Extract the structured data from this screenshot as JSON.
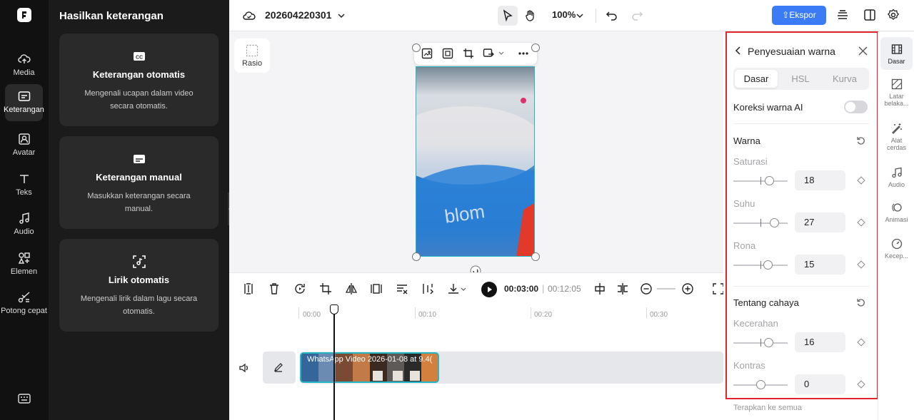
{
  "rail": {
    "items": [
      {
        "label": "Media",
        "icon": "cloud-upload-icon"
      },
      {
        "label": "Keterangan",
        "icon": "captions-icon"
      },
      {
        "label": "Avatar",
        "icon": "avatar-icon"
      },
      {
        "label": "Teks",
        "icon": "text-icon"
      },
      {
        "label": "Audio",
        "icon": "music-icon"
      },
      {
        "label": "Elemen",
        "icon": "elements-icon"
      },
      {
        "label": "Potong cepat",
        "icon": "quick-cut-icon"
      }
    ]
  },
  "panel": {
    "title": "Hasilkan keterangan",
    "cards": [
      {
        "title": "Keterangan otomatis",
        "desc": "Mengenali ucapan dalam video secara otomatis."
      },
      {
        "title": "Keterangan manual",
        "desc": "Masukkan keterangan secara manual."
      },
      {
        "title": "Lirik otomatis",
        "desc": "Mengenali lirik dalam lagu secara otomatis."
      }
    ]
  },
  "topbar": {
    "project_name": "202604220301",
    "zoom": "100%",
    "export_label": "Ekspor"
  },
  "canvas": {
    "ratio_label": "Rasio"
  },
  "timeline": {
    "current_time": "00:03:00",
    "separator": "|",
    "total_time": "00:12:05",
    "ticks": [
      "00:00",
      "00:10",
      "00:20",
      "00:30"
    ],
    "clip_label": "WhatsApp Video 2026-01-08 at 9.4("
  },
  "adjust": {
    "title": "Penyesuaian warna",
    "tabs": [
      "Dasar",
      "HSL",
      "Kurva"
    ],
    "active_tab": "Dasar",
    "ai_label": "Koreksi warna AI",
    "ai_enabled": false,
    "sections": [
      {
        "title": "Warna",
        "rows": [
          {
            "label": "Saturasi",
            "value": "18"
          },
          {
            "label": "Suhu",
            "value": "27"
          },
          {
            "label": "Rona",
            "value": "15"
          }
        ]
      },
      {
        "title": "Tentang cahaya",
        "rows": [
          {
            "label": "Kecerahan",
            "value": "16"
          },
          {
            "label": "Kontras",
            "value": "0"
          }
        ]
      }
    ],
    "apply_all": "Terapkan ke semua"
  },
  "side_tabs": [
    {
      "label": "Dasar",
      "icon": "film-icon"
    },
    {
      "label": "Latar belaka...",
      "icon": "background-icon"
    },
    {
      "label": "Alat cerdas",
      "icon": "magic-wand-icon"
    },
    {
      "label": "Audio",
      "icon": "music-icon"
    },
    {
      "label": "Animasi",
      "icon": "animation-icon"
    },
    {
      "label": "Kecep...",
      "icon": "speed-icon"
    }
  ],
  "colors": {
    "accent": "#3b7cf6",
    "selection": "#25b7c5",
    "highlight_outline": "#e0252b"
  }
}
